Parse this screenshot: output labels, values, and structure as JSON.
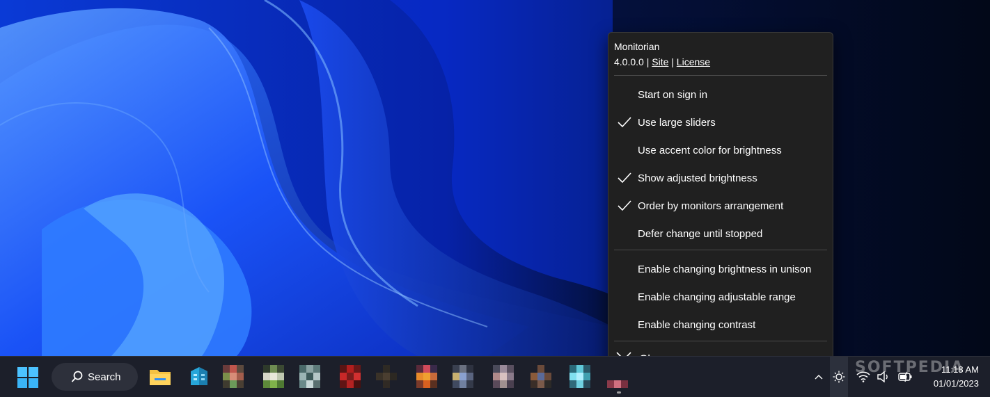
{
  "menu": {
    "app_name": "Monitorian",
    "version": "4.0.0.0",
    "sep_char": "|",
    "site_link": "Site",
    "license_link": "License",
    "items": [
      {
        "label": "Start on sign in",
        "checked": false
      },
      {
        "label": "Use large sliders",
        "checked": true
      },
      {
        "label": "Use accent color for brightness",
        "checked": false
      },
      {
        "label": "Show adjusted brightness",
        "checked": true
      },
      {
        "label": "Order by monitors arrangement",
        "checked": true
      },
      {
        "label": "Defer change until stopped",
        "checked": false
      }
    ],
    "items2": [
      {
        "label": "Enable changing brightness in unison",
        "checked": false
      },
      {
        "label": "Enable changing adjustable range",
        "checked": false
      },
      {
        "label": "Enable changing contrast",
        "checked": false
      }
    ],
    "close_label": "Close"
  },
  "taskbar": {
    "search_label": "Search",
    "time": "11:18 AM",
    "date": "01/01/2023"
  },
  "watermark": "SOFTPEDIA",
  "colors": {
    "menu_bg": "#202020",
    "accent": "#0a4cff",
    "taskbar_bg": "#1c1f2a"
  }
}
